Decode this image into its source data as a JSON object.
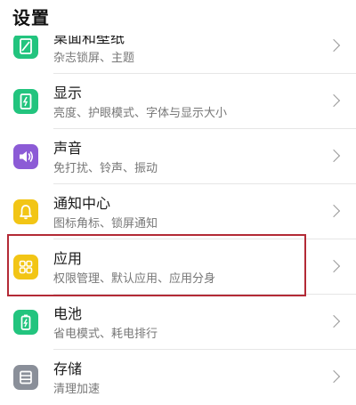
{
  "header": {
    "title": "设置"
  },
  "items": [
    {
      "label": "桌面和壁纸",
      "sub": "杂志锁屏、主题",
      "icon": "wallpaper-icon",
      "color": "#22c47e"
    },
    {
      "label": "显示",
      "sub": "亮度、护眼模式、字体与显示大小",
      "icon": "display-icon",
      "color": "#22c47e"
    },
    {
      "label": "声音",
      "sub": "免打扰、铃声、振动",
      "icon": "sound-icon",
      "color": "#8c5bd6"
    },
    {
      "label": "通知中心",
      "sub": "图标角标、锁屏通知",
      "icon": "bell-icon",
      "color": "#f2c515"
    },
    {
      "label": "应用",
      "sub": "权限管理、默认应用、应用分身",
      "icon": "apps-icon",
      "color": "#f2c515"
    },
    {
      "label": "电池",
      "sub": "省电模式、耗电排行",
      "icon": "battery-icon",
      "color": "#22c47e"
    },
    {
      "label": "存储",
      "sub": "清理加速",
      "icon": "storage-icon",
      "color": "#8a8f99"
    }
  ],
  "highlight_color": "#b32a36"
}
